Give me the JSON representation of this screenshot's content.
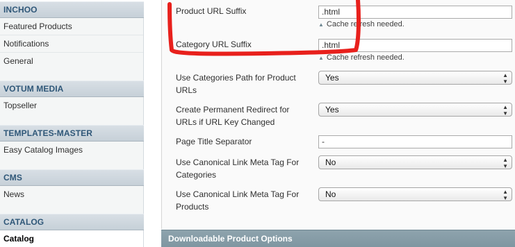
{
  "sidebar": {
    "sections": [
      {
        "title": "INCHOO",
        "items": [
          {
            "label": "Featured Products"
          },
          {
            "label": "Notifications"
          },
          {
            "label": "General"
          }
        ]
      },
      {
        "title": "VOTUM MEDIA",
        "items": [
          {
            "label": "Topseller"
          }
        ]
      },
      {
        "title": "TEMPLATES-MASTER",
        "items": [
          {
            "label": "Easy Catalog Images"
          }
        ]
      },
      {
        "title": "CMS",
        "items": [
          {
            "label": "News"
          }
        ]
      },
      {
        "title": "CATALOG",
        "items": [
          {
            "label": "Catalog",
            "active": true
          }
        ]
      }
    ]
  },
  "settings": {
    "product_url_suffix": {
      "label": "Product URL Suffix",
      "value": ".html",
      "hint": "Cache refresh needed."
    },
    "category_url_suffix": {
      "label": "Category URL Suffix",
      "value": ".html",
      "hint": "Cache refresh needed."
    },
    "use_categories_path": {
      "label_line1": "Use Categories Path for Product",
      "label_line2": "URLs",
      "value": "Yes"
    },
    "permanent_redirect": {
      "label_line1": "Create Permanent Redirect for",
      "label_line2": "URLs if URL Key Changed",
      "value": "Yes"
    },
    "page_title_separator": {
      "label": "Page Title Separator",
      "value": "-"
    },
    "canonical_categories": {
      "label_line1": "Use Canonical Link Meta Tag For",
      "label_line2": "Categories",
      "value": "No"
    },
    "canonical_products": {
      "label_line1": "Use Canonical Link Meta Tag For",
      "label_line2": "Products",
      "value": "No"
    }
  },
  "downloadable_section": {
    "title": "Downloadable Product Options"
  },
  "colors": {
    "section_header_text": "#2f5778",
    "section_bar_bg": "#7f96a1",
    "annotation_red": "#e8201c"
  },
  "icons": {
    "hint_marker": "triangle-up-icon",
    "select_arrows": "updown-arrows-icon"
  }
}
